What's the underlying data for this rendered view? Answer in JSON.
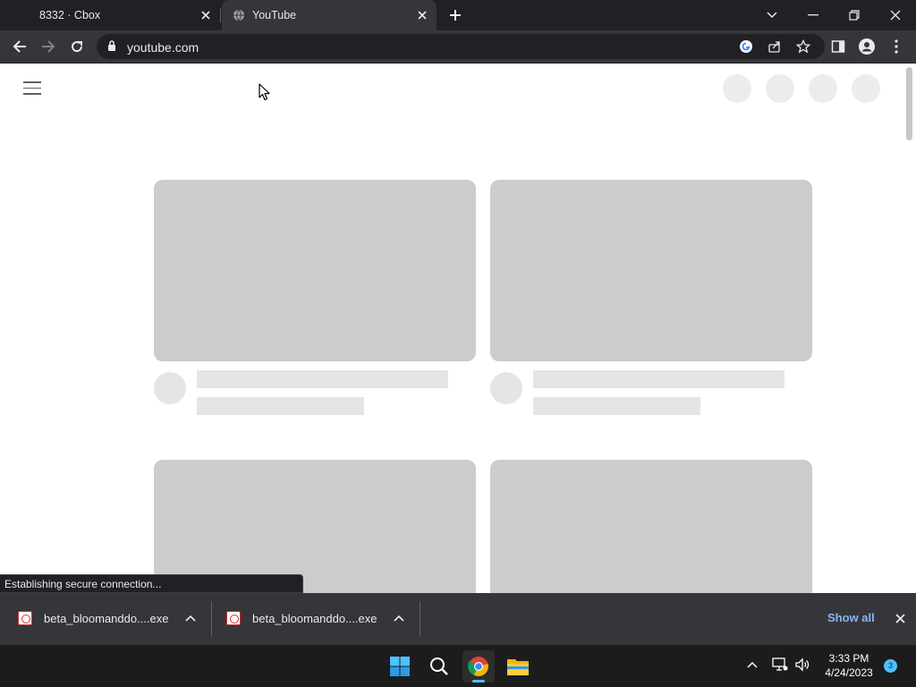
{
  "browser": {
    "tabs": [
      {
        "title": "8332 · Cbox",
        "active": false
      },
      {
        "title": "YouTube",
        "active": true
      }
    ],
    "address": "youtube.com"
  },
  "status_text": "Establishing secure connection...",
  "downloads": {
    "items": [
      {
        "name": "beta_bloomanddo....exe"
      },
      {
        "name": "beta_bloomanddo....exe"
      }
    ],
    "show_all_label": "Show all"
  },
  "taskbar": {
    "time": "3:33 PM",
    "date": "4/24/2023",
    "notification_count": "3"
  },
  "colors": {
    "tabstrip": "#202124",
    "toolbar": "#35363a",
    "placeholder_thumb": "#cccccc",
    "placeholder_text": "#e5e5e5",
    "link": "#8ab4f8",
    "accent": "#4cc2ff"
  }
}
